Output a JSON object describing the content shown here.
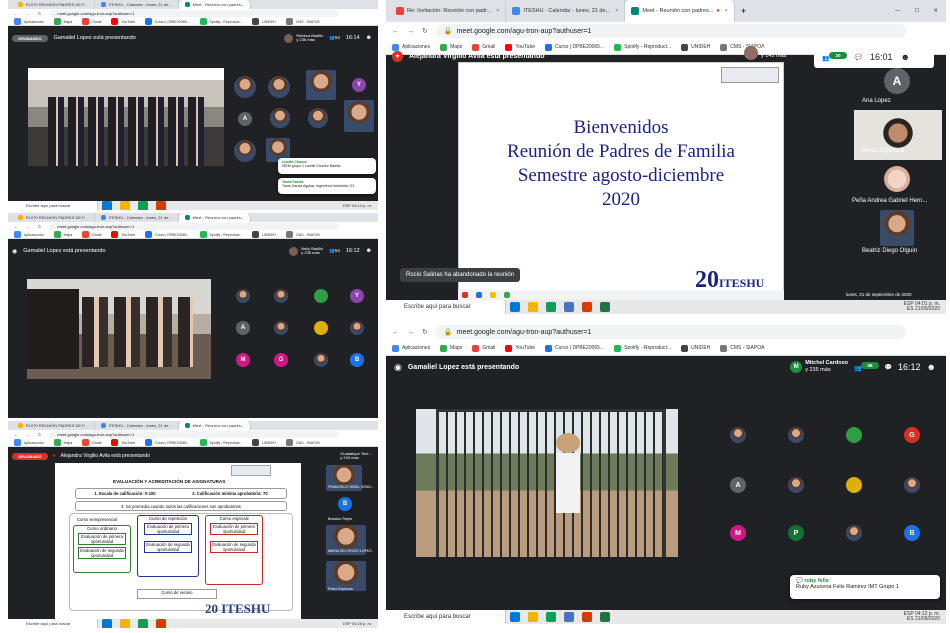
{
  "colors": {
    "meet_bg": "#202124",
    "accent_green": "#1e8e3e",
    "recording_red": "#d93025"
  },
  "q1": {
    "tabs": [
      "EL070 REUNIÓN PADRES DE F...",
      "ITESHU - Calendar - lunes, 21 de...",
      "Meet - Reunión con padres..."
    ],
    "url": "meet.google.com/agu-tron-aup?authuser=1",
    "bookmarks": [
      "Aplicaciones",
      "Maps",
      "Gmail",
      "YouTube",
      "Curso | DPBE20065...",
      "Spotify - Reproduct...",
      "UNIDEH",
      "CMS - SIAPOA"
    ],
    "recording": "GRABANDO",
    "presenter": "Gamaliel Lopez está presentando",
    "top_user": {
      "name": "Rebeca Badillo",
      "sub": "y 236 más"
    },
    "count": "54",
    "time": "16:14",
    "tiles": [
      "Y",
      "A"
    ],
    "chat": [
      {
        "name": "Lizette Chavez",
        "text": "ISEM grupo 1 Lizette Chavez Badillo"
      },
      {
        "name": "Tania Garcia",
        "text": "Tania Garcia Aguilar, Ingeniería Industrial, G3"
      }
    ],
    "taskbar_search": "Escribe aquí para buscar",
    "clock": "ESP 04:14 p. m."
  },
  "q2": {
    "tabs": [
      "EL070 REUNIÓN PADRES DE F...",
      "ITESHU - Calendar - lunes, 21 de...",
      "Meet - Reunión con padres..."
    ],
    "url": "meet.google.com/agu-tron-aup?authuser=1",
    "bookmarks": [
      "Aplicaciones",
      "Maps",
      "Gmail",
      "YouTube",
      "Curso | DPBE20065...",
      "Spotify - Reproduct...",
      "UNIDEH",
      "CMS - SIAPOA"
    ],
    "presenter": "Gamaliel Lopez está presentando",
    "top_user": {
      "name": "Nelly Badillo",
      "sub": "y 236 más"
    },
    "count": "54",
    "time": "16:12",
    "tiles": [
      "Y",
      "A",
      "M",
      "G",
      "B"
    ]
  },
  "q3": {
    "tabs": [
      "EL070 REUNIÓN PADRES DE F...",
      "ITESHU - Calendar - lunes, 21 de...",
      "Meet - Reunión con padres..."
    ],
    "url": "meet.google.com/agu-tron-aup?authuser=1",
    "bookmarks": [
      "Aplicaciones",
      "Maps",
      "Gmail",
      "YouTube",
      "Curso | DPBE20065...",
      "Spotify - Reproduct...",
      "UNIDEH",
      "CMS - SIAPOA"
    ],
    "recording": "GRABANDO",
    "presenter": "Alejandra Virgilio Avila está presentando",
    "top_user": {
      "name": "Guadalupe Tere...",
      "sub": "y 243 más"
    },
    "slide": {
      "title": "EVALUACIÓN Y ACREDITACIÓN DE ASIGNATURAS",
      "row1a": "1. Escala de calificación: 0-100",
      "row1b": "2. Calificación mínima aprobatoria: 70",
      "row2": "3. Se promedia cuando todos las calificaciones son aprobatorias",
      "semestral": "Curso semipresencial",
      "col1": {
        "title": "Curso ordinario",
        "a": "Evaluación de primera oportunidad",
        "b": "Evaluación de segunda oportunidad"
      },
      "col2": {
        "title": "Curso de repetición",
        "a": "Evaluación de primera oportunidad",
        "b": "Evaluación de segunda oportunidad"
      },
      "col3": {
        "title": "Curso especial",
        "a": "Evaluación de primera oportunidad",
        "b": "Evaluación de segunda oportunidad"
      },
      "verano": "Curso de verano",
      "logo_mark": "20 ITESHU"
    },
    "side": [
      {
        "label": "FRANCISCO GIBEL GRAN..."
      },
      {
        "label": "Brandon Reyes"
      },
      {
        "label": "MARIA DEL ROCIO LOPEZ..."
      },
      {
        "label": "Pedro Espinoza"
      }
    ],
    "side_letter": "B",
    "taskbar_search": "Escribe aquí para buscar",
    "clock": "ESP 04:26 p. m."
  },
  "q4": {
    "tabs": [
      "Re: Invitación: Reunión con padr...",
      "ITESHU - Calendar - lunes, 21 de...",
      "Meet - Reunión con padres..."
    ],
    "url": "meet.google.com/agu-tron-aup?authuser=1",
    "bookmarks": [
      "Aplicaciones",
      "Maps",
      "Gmail",
      "YouTube",
      "Curso | DPBE20065...",
      "Spotify - Reproduct...",
      "UNIDEH",
      "CMS - SIAPOA"
    ],
    "presenter": "Alejandra Virgilio Avila está presentando",
    "top_user": {
      "name": "Anahi Cuchillo",
      "sub": "y 141 más"
    },
    "count": "20",
    "time": "16:01",
    "slide": {
      "l1": "Bienvenidos",
      "l2": "Reunión de Padres de Familia",
      "l3": "Semestre agosto-diciembre",
      "l4": "2020",
      "logo": "ITESHU"
    },
    "toast": "Rocio Salinas ha abandonado la reunión",
    "participants": [
      {
        "letter": "A",
        "name": "Ana Lopez"
      },
      {
        "name": "Pérez Espinoza"
      },
      {
        "name": "Peña Andrea Gabriel Hern..."
      },
      {
        "name": "Beatriz Diego Olguin"
      }
    ],
    "date_line": "lunes, 21 de septiembre de 2020",
    "taskbar_search": "Escribe aquí para buscar",
    "clock": "ESP 04:01 p. m.",
    "clock2": "ES 21/09/2020"
  },
  "q5": {
    "url": "meet.google.com/agu-tron-aup?authuser=1",
    "bookmarks": [
      "Aplicaciones",
      "Maps",
      "Gmail",
      "YouTube",
      "Curso | DPBE20065...",
      "Spotify - Reproduct...",
      "UNIDEH",
      "CMS - SIAPOA"
    ],
    "presenter": "Gamaliel Lopez está presentando",
    "top_user": {
      "letter": "M",
      "name": "Mitchel Cardoso",
      "sub": "y 235 más"
    },
    "count": "96",
    "time": "16:12",
    "tiles": [
      "G",
      "A",
      "M",
      "P",
      "B"
    ],
    "chat": {
      "name": "ruby felix",
      "text": "Ruby Azucena Felix Ramirez IMT Grupo 1"
    },
    "taskbar_search": "Escribe aquí para buscar",
    "clock": "ESP 04:12 p. m.",
    "clock2": "ES 21/09/2020"
  }
}
